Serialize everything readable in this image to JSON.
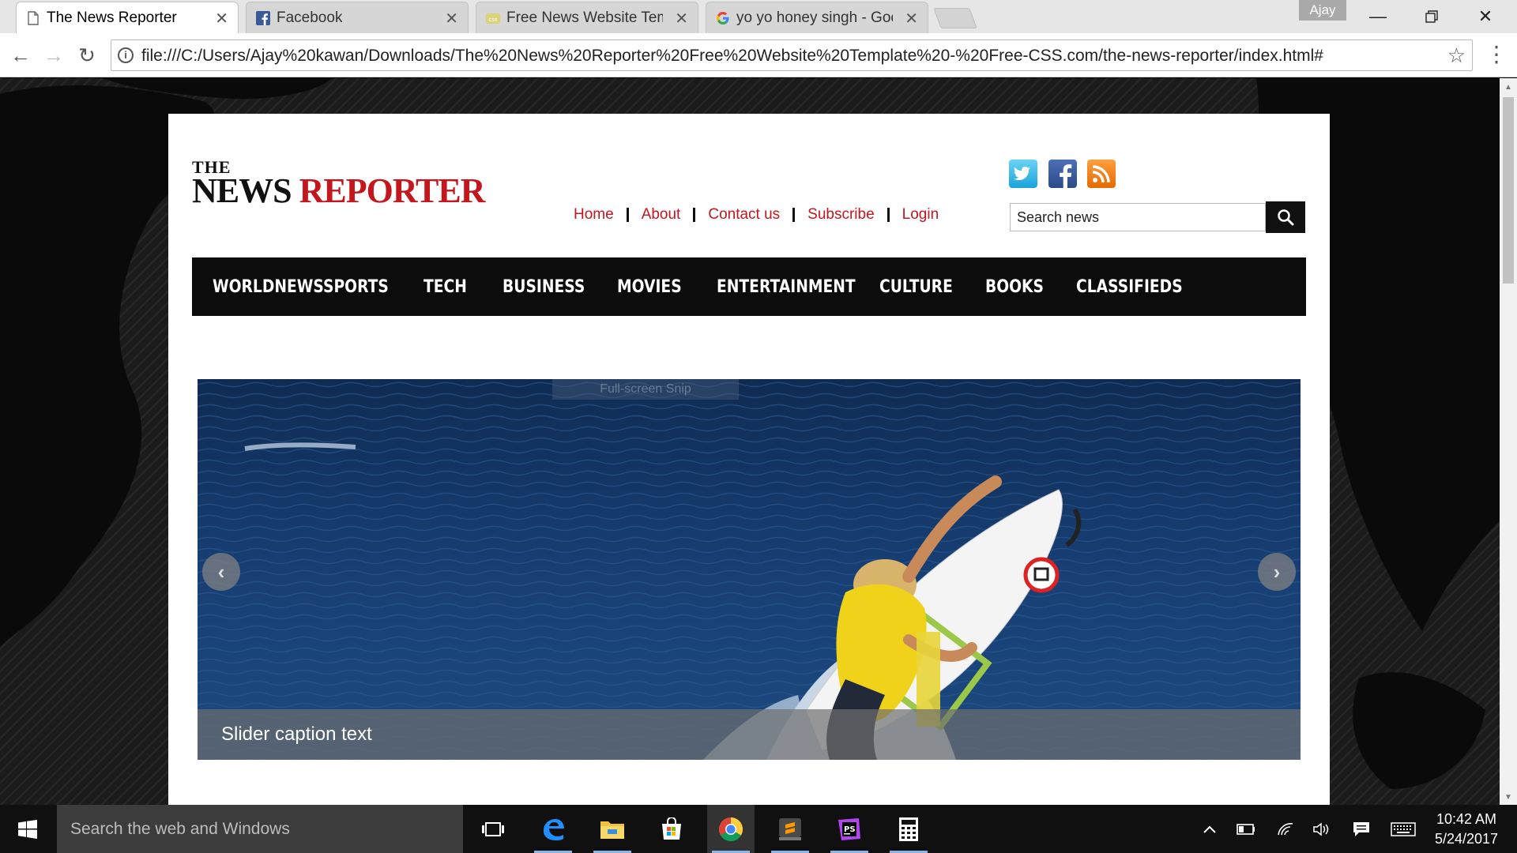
{
  "browser": {
    "tabs": [
      {
        "title": "The News Reporter",
        "icon": "page-icon",
        "active": true
      },
      {
        "title": "Facebook",
        "icon": "facebook-icon",
        "active": false
      },
      {
        "title": "Free News Website Temp",
        "icon": "css-icon",
        "active": false
      },
      {
        "title": "yo yo honey singh - Goo",
        "icon": "google-icon",
        "active": false
      }
    ],
    "profile_name": "Ajay",
    "url": "file:///C:/Users/Ajay%20kawan/Downloads/The%20News%20Reporter%20Free%20Website%20Template%20-%20Free-CSS.com/the-news-reporter/index.html#"
  },
  "site": {
    "logo": {
      "the": "THE",
      "news": "NEWS",
      "reporter": "REPORTER"
    },
    "top_links": [
      "Home",
      "About",
      "Contact us",
      "Subscribe",
      "Login"
    ],
    "social": [
      "twitter-icon",
      "facebook-icon",
      "rss-icon"
    ],
    "search": {
      "placeholder": "Search news"
    },
    "nav": [
      "WORLDNEWS",
      "SPORTS",
      "TECH",
      "BUSINESS",
      "MOVIES",
      "ENTERTAINMENT",
      "CULTURE",
      "BOOKS",
      "CLASSIFIEDS"
    ],
    "slider": {
      "caption": "Slider caption text",
      "overlay_label": "Full-screen Snip"
    }
  },
  "taskbar": {
    "search_placeholder": "Search the web and Windows",
    "apps": [
      "task-view-icon",
      "edge-icon",
      "file-explorer-icon",
      "store-icon",
      "chrome-icon",
      "sublime-icon",
      "phpstorm-icon",
      "calculator-icon"
    ],
    "time": "10:42 AM",
    "date": "5/24/2017"
  },
  "colors": {
    "accent_red": "#c4161c",
    "nav_bg": "#0c0c0c",
    "taskbar_bg": "#101010"
  }
}
